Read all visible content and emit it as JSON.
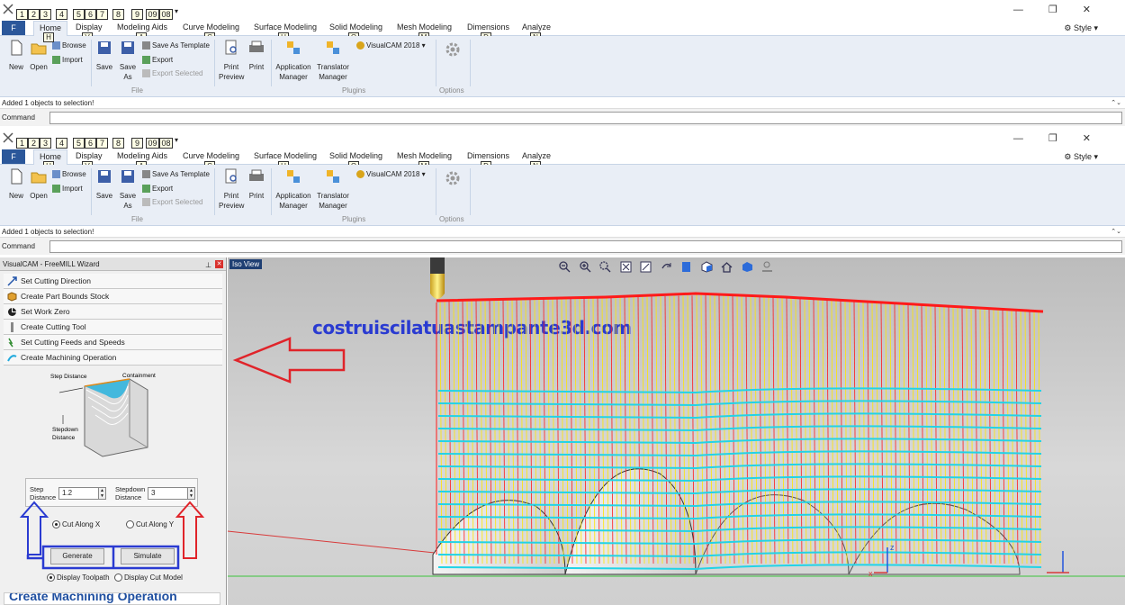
{
  "qat": {
    "keytips": [
      "1",
      "2",
      "3",
      "4",
      "5",
      "6",
      "7",
      "8",
      "9",
      "09",
      "08"
    ]
  },
  "tabs": {
    "file": "F",
    "items": [
      "Home",
      "Display",
      "Modeling Aids",
      "Curve Modeling",
      "Surface Modeling",
      "Solid Modeling",
      "Mesh Modeling",
      "Dimensions",
      "Analyze"
    ],
    "keytips": [
      "H",
      "V",
      "A",
      "C",
      "U",
      "O",
      "M",
      "D",
      "N"
    ],
    "style": "Style"
  },
  "ribbon": {
    "new": "New",
    "open": "Open",
    "browse": "Browse",
    "import": "Import",
    "save": "Save",
    "save_as_1": "Save",
    "save_as_2": "As",
    "save_as_template": "Save As Template",
    "export": "Export",
    "export_selected": "Export Selected",
    "print_preview_1": "Print",
    "print_preview_2": "Preview",
    "print": "Print",
    "app_manager_1": "Application",
    "app_manager_2": "Manager",
    "translator_1": "Translator",
    "translator_2": "Manager",
    "visualcam": "VisualCAM 2018",
    "groups": {
      "file": "File",
      "plugins": "Plugins",
      "options": "Options"
    }
  },
  "status": {
    "message": "Added 1 objects to selection!"
  },
  "command": {
    "label": "Command"
  },
  "panel": {
    "title": "VisualCAM - FreeMILL Wizard",
    "steps": [
      "Set Cutting Direction",
      "Create Part Bounds Stock",
      "Set Work Zero",
      "Create Cutting Tool",
      "Set Cutting Feeds and Speeds",
      "Create Machining Operation"
    ],
    "diagram": {
      "step_distance": "Step Distance",
      "containment": "Containment",
      "stepdown_1": "Stepdown",
      "stepdown_2": "Distance"
    },
    "step_label_1": "Step",
    "step_label_2": "Distance",
    "step_value": "1.2",
    "stepdown_label_1": "Stepdown",
    "stepdown_label_2": "Distance",
    "stepdown_value": "3",
    "cut_along_x": "Cut Along X",
    "cut_along_y": "Cut Along Y",
    "generate": "Generate",
    "simulate": "Simulate",
    "display_toolpath": "Display Toolpath",
    "display_cut_model": "Display Cut Model",
    "bottom_heading": "Create Machining Operation"
  },
  "viewport": {
    "label": "Iso View",
    "watermark": "costruiscilatuastampante3d.com",
    "axis_z": "z",
    "axis_x": "x"
  },
  "colors": {
    "accent": "#2b579a",
    "ribbon_bg": "#e9eef6",
    "toolpath_red": "#ff1a1a",
    "toolpath_yellow": "#ffe600",
    "toolpath_cyan": "#22d3e6",
    "annotation_red": "#e0242a",
    "annotation_blue": "#2a3bd1"
  }
}
